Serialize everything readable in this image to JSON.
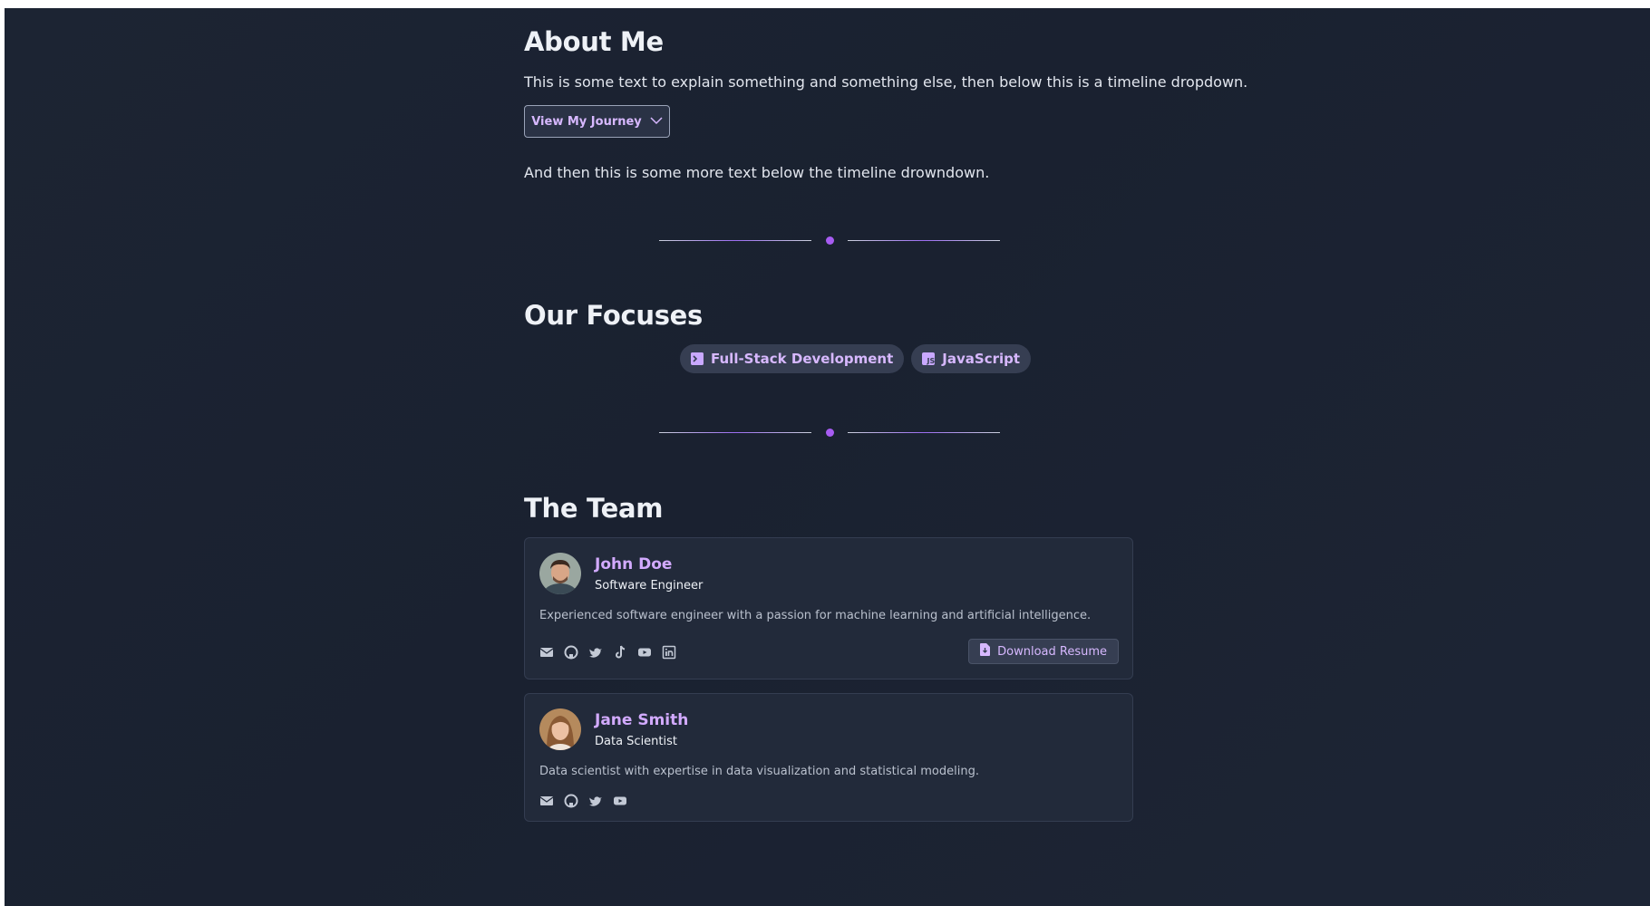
{
  "about": {
    "title": "About Me",
    "intro": "This is some text to explain something and something else, then below this is a timeline dropdown.",
    "journey_button": "View My Journey",
    "outro": "And then this is some more text below the timeline drowndown."
  },
  "focuses": {
    "title": "Our Focuses",
    "chips": [
      {
        "label": "Full-Stack Development",
        "icon": "terminal-icon"
      },
      {
        "label": "JavaScript",
        "icon": "javascript-icon"
      }
    ]
  },
  "team": {
    "title": "The Team",
    "members": [
      {
        "name": "John Doe",
        "role": "Software Engineer",
        "bio": "Experienced software engineer with a passion for machine learning and artificial intelligence.",
        "socials": [
          "email-icon",
          "github-icon",
          "twitter-icon",
          "tiktok-icon",
          "youtube-icon",
          "linkedin-icon"
        ],
        "resume_label": "Download Resume"
      },
      {
        "name": "Jane Smith",
        "role": "Data Scientist",
        "bio": "Data scientist with expertise in data visualization and statistical modeling.",
        "socials": [
          "email-icon",
          "github-icon",
          "twitter-icon",
          "youtube-icon"
        ]
      }
    ]
  },
  "colors": {
    "background": "#1c2433",
    "accent": "#d2aaff",
    "divider_dot": "#a75cf2",
    "card": "#222a3a"
  }
}
